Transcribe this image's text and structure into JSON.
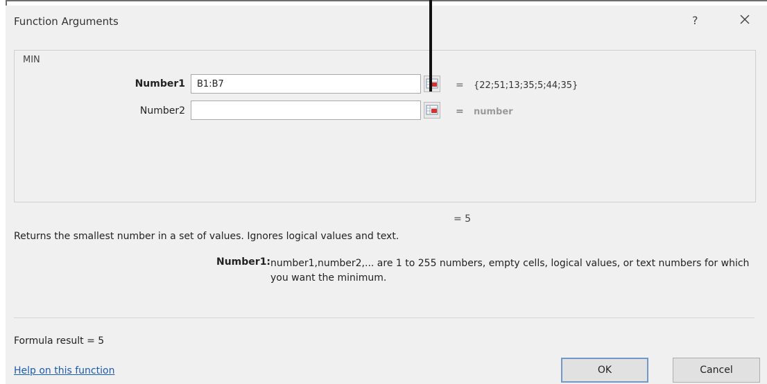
{
  "dialog": {
    "title": "Function Arguments",
    "help_glyph": "?",
    "function_name": "MIN"
  },
  "arguments": [
    {
      "label": "Number1",
      "value": "B1:B7",
      "eq": "=",
      "evaluated": "{22;51;13;35;5;44;35}"
    },
    {
      "label": "Number2",
      "value": "",
      "eq": "=",
      "evaluated": "number"
    }
  ],
  "result_line": "=  5",
  "description": "Returns the smallest number in a set of values. Ignores logical values and text.",
  "arg_help": {
    "label": "Number1:",
    "text": "number1,number2,... are 1 to 255 numbers, empty cells, logical values, or text numbers for which you want the minimum."
  },
  "formula_result": "Formula result =   5",
  "help_link": "Help on this function",
  "buttons": {
    "ok": "OK",
    "cancel": "Cancel"
  },
  "icons": {
    "ref_button": "range-select-icon",
    "close": "close-icon"
  }
}
